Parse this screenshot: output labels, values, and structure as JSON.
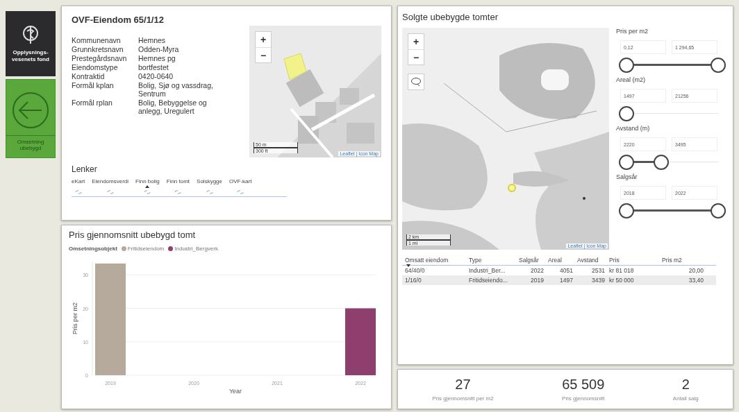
{
  "sidebar": {
    "logo_text": "Opplysnings-vesenets fond",
    "nav_button": {
      "label": "Omsetning ubebygd"
    }
  },
  "property": {
    "title": "OVF-Eiendom 65/1/12",
    "fields": [
      {
        "label": "Kommunenavn",
        "value": "Hemnes"
      },
      {
        "label": "Grunnkretsnavn",
        "value": "Odden-Myra"
      },
      {
        "label": "Prestegårdsnavn",
        "value": "Hemnes pg"
      },
      {
        "label": "Eiendomstype",
        "value": "bortfestet"
      },
      {
        "label": "Kontraktid",
        "value": "0420-0640"
      },
      {
        "label": "Formål kplan",
        "value": "Bolig, Sjø og vassdrag, Sentrum"
      },
      {
        "label": "Formål rplan",
        "value": "Bolig, Bebyggelse og anlegg, Uregulert"
      }
    ],
    "map": {
      "zoom_in": "+",
      "zoom_out": "−",
      "scale": [
        "50 m",
        "300 ft"
      ],
      "attribution": "Leaflet | Icon Map"
    },
    "links_title": "Lenker",
    "links": [
      {
        "label": "eKart",
        "sorted": false
      },
      {
        "label": "Eiendomsverdi",
        "sorted": false
      },
      {
        "label": "Finn bolig",
        "sorted": true
      },
      {
        "label": "Finn tomt",
        "sorted": false
      },
      {
        "label": "Solskygge",
        "sorted": false
      },
      {
        "label": "OVF-kart",
        "sorted": false
      }
    ]
  },
  "price_chart": {
    "title": "Pris gjennomsnitt ubebygd tomt",
    "legend_title": "Omsetningsobjekt",
    "chart_data": {
      "type": "bar",
      "xlabel": "Year",
      "ylabel": "Pris per m2",
      "categories": [
        "2019",
        "2020",
        "2021",
        "2022"
      ],
      "ylim": [
        0,
        34
      ],
      "yticks": [
        0,
        10,
        20,
        30
      ],
      "stacked": true,
      "grid": true,
      "series": [
        {
          "name": "Fritidseiendom",
          "color": "#b5aa9b",
          "values": [
            33.4,
            null,
            null,
            null
          ]
        },
        {
          "name": "Industri_Bergverk",
          "color": "#8f3f6e",
          "values": [
            null,
            null,
            null,
            20
          ]
        }
      ]
    }
  },
  "sales": {
    "title": "Solgte ubebygde tomter",
    "map": {
      "zoom_in": "+",
      "zoom_out": "−",
      "scale": [
        "2 km",
        "1 mi"
      ],
      "attribution": "Leaflet | Icon Map"
    },
    "filters": [
      {
        "label": "Pris per m2",
        "min": "0,12",
        "max": "1 294,65",
        "thumbs": [
          {
            "level": 0
          },
          {
            "level": 1
          }
        ]
      },
      {
        "label": "Areal (m2)",
        "min": "1497",
        "max": "21256",
        "thumbs": [
          {
            "level": 0
          }
        ]
      },
      {
        "label": "Avstand (m)",
        "min": "2220",
        "max": "3495",
        "thumbs": [
          {
            "level": 0
          },
          {
            "level": 0.38
          }
        ]
      },
      {
        "label": "Salgsår",
        "min": "2018",
        "max": "2022",
        "thumbs": [
          {
            "level": 0
          },
          {
            "level": 1
          }
        ]
      }
    ],
    "table": {
      "columns": [
        {
          "label": "Omsatt eiendom",
          "sorted": true
        },
        {
          "label": "Type",
          "sorted": false
        },
        {
          "label": "Salgsår",
          "sorted": false
        },
        {
          "label": "Areal",
          "sorted": false
        },
        {
          "label": "Avstand",
          "sorted": false
        },
        {
          "label": "Pris",
          "sorted": false
        },
        {
          "label": "Pris m2",
          "sorted": false
        }
      ],
      "rows": [
        [
          "64/40/0",
          "Industri_Ber...",
          "2022",
          "4051",
          "2531",
          "kr 81 018",
          "20,00"
        ],
        [
          "1/16/0",
          "Fritidseiendo...",
          "2019",
          "1497",
          "3439",
          "kr 50 000",
          "33,40"
        ]
      ]
    }
  },
  "kpis": [
    {
      "value": "27",
      "label": "Pris gjennomsnitt per m2"
    },
    {
      "value": "65 509",
      "label": "Pris gjennomsnitt"
    },
    {
      "value": "2",
      "label": "Antall salg"
    }
  ]
}
